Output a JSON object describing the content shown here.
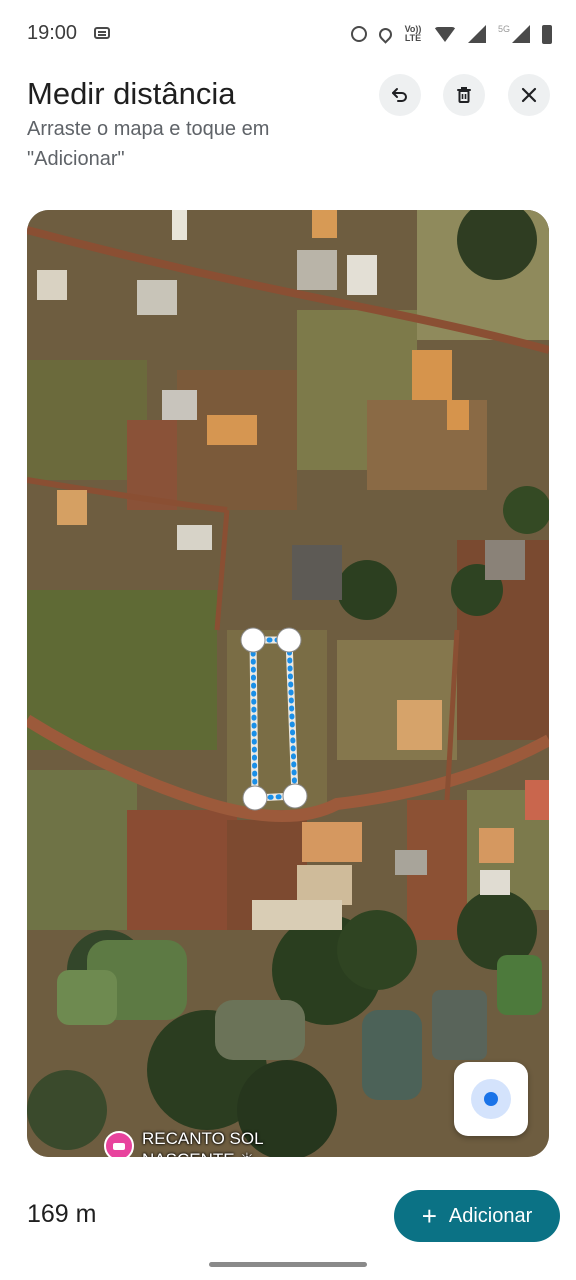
{
  "status_bar": {
    "time": "19:00",
    "network_label": "Vo)) LTE",
    "signal_label": "5G",
    "icons": [
      "message-icon",
      "alarm-icon",
      "location-icon",
      "volte-icon",
      "wifi-icon",
      "signal-icon",
      "signal-5g-icon",
      "battery-icon"
    ]
  },
  "header": {
    "title": "Medir distância",
    "subtitle": "Arraste o mapa e toque em \"Adicionar\"",
    "buttons": [
      {
        "name": "undo-button",
        "icon": "undo-icon"
      },
      {
        "name": "delete-button",
        "icon": "trash-icon"
      },
      {
        "name": "close-button",
        "icon": "close-icon"
      }
    ]
  },
  "map": {
    "poi_label": "RECANTO SOL NASCENTE ☀",
    "poi_icon": "hotel-icon",
    "location_button_icon": "my-location-icon",
    "measure_line_color": "#1a8fe8"
  },
  "bottom": {
    "distance": "169 m",
    "add_label": "Adicionar",
    "add_color": "#0b7285"
  }
}
